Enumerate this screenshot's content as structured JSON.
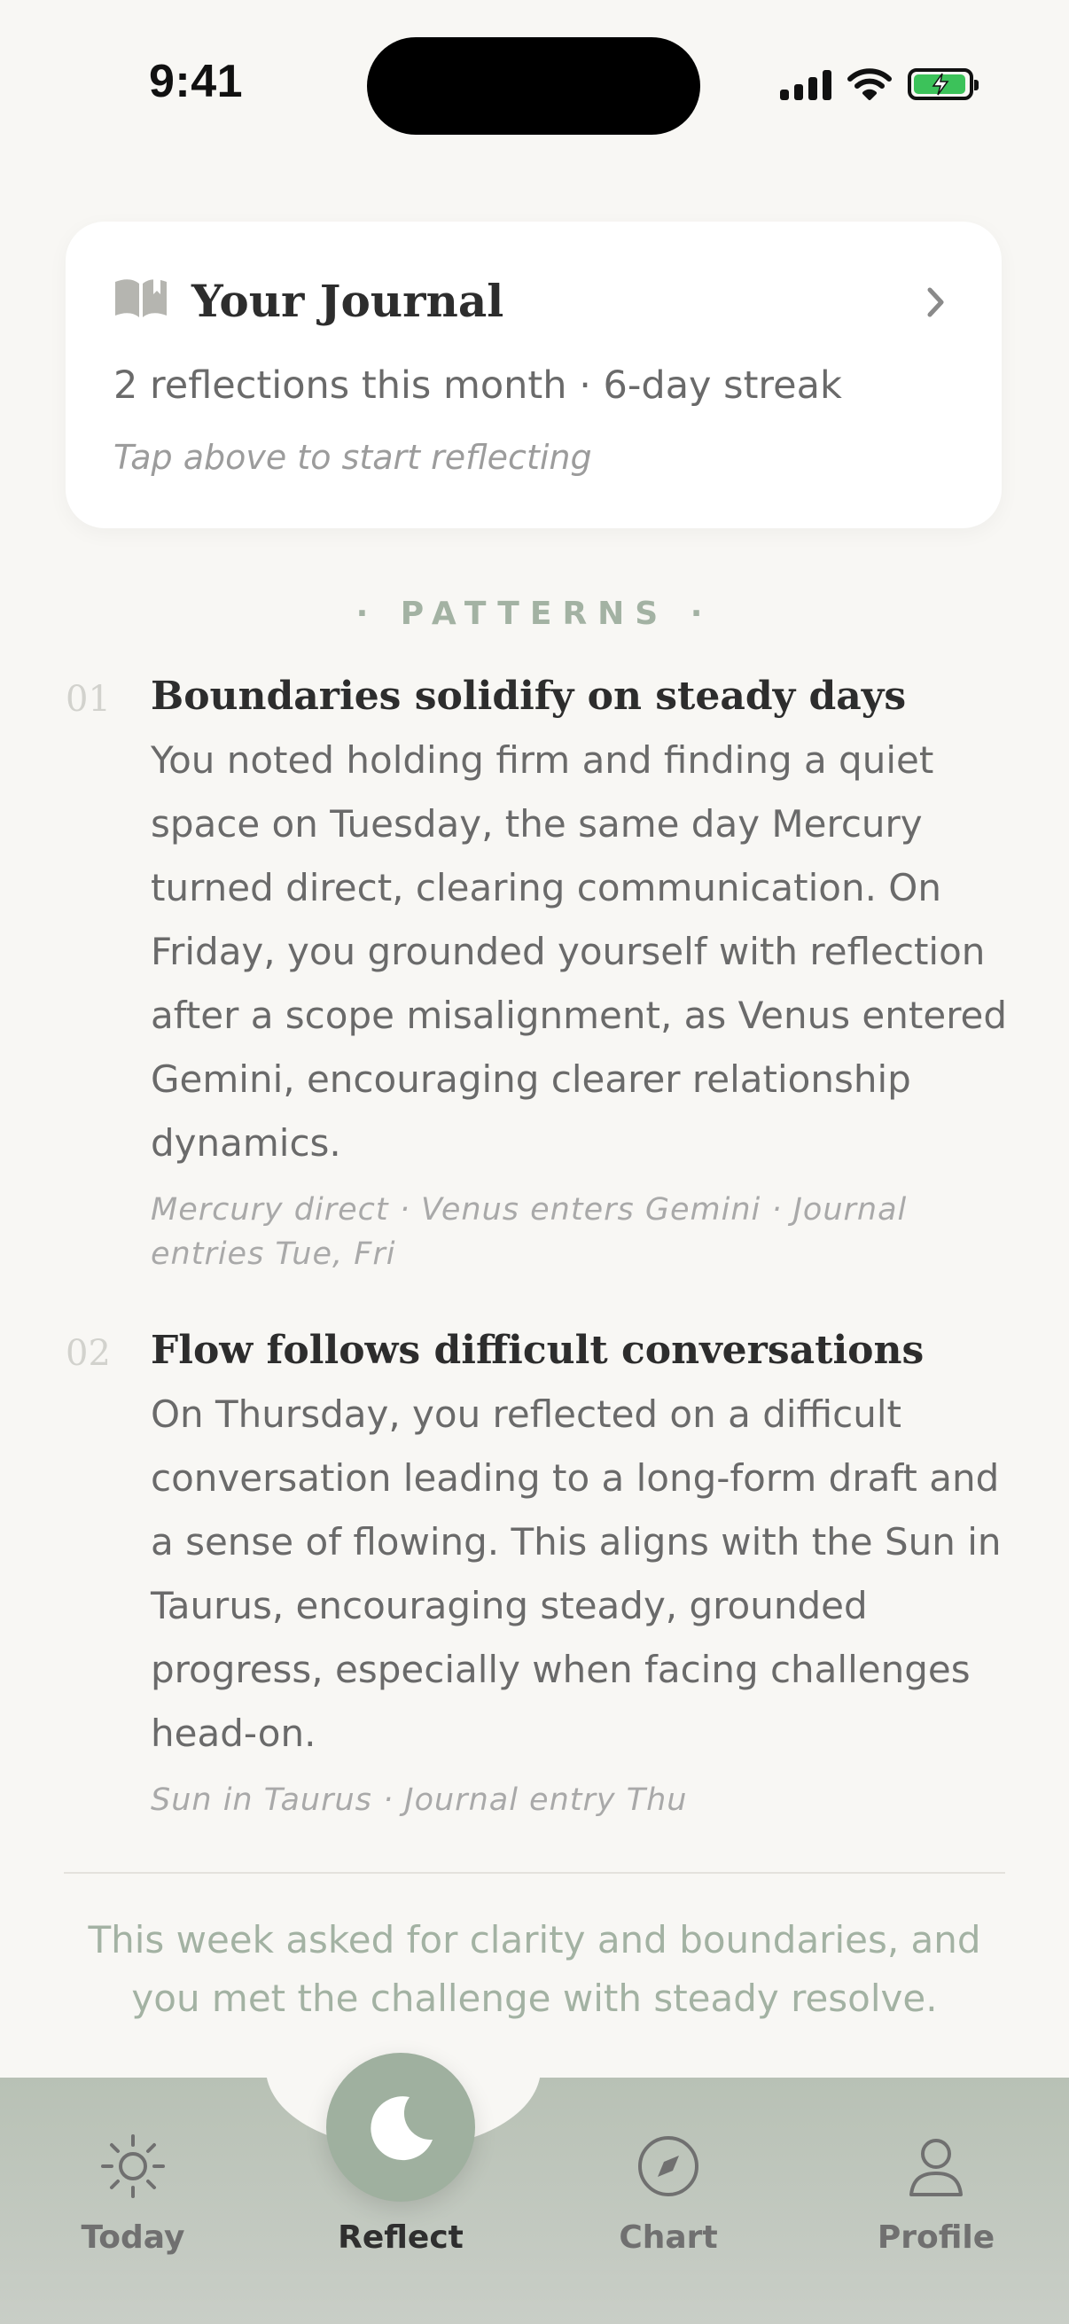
{
  "status_bar": {
    "time": "9:41"
  },
  "journal_card": {
    "icon": "open-book-icon",
    "title": "Your Journal",
    "stats": "2 reflections this month · 6-day streak",
    "hint": "Tap above to start reflecting"
  },
  "patterns": {
    "label": "· PATTERNS ·",
    "items": [
      {
        "number": "01",
        "title": "Boundaries solidify on steady days",
        "text": "You noted holding firm and finding a quiet space on Tuesday, the same day Mercury turned direct, clearing communication. On Friday, you grounded yourself with reflection after a scope misalignment, as Venus entered Gemini, encouraging clearer relationship dynamics.",
        "meta": "Mercury direct · Venus enters Gemini · Journal entries Tue, Fri"
      },
      {
        "number": "02",
        "title": "Flow follows difficult conversations",
        "text": "On Thursday, you reflected on a difficult conversation leading to a long-form draft and a sense of flowing. This aligns with the Sun in Taurus, encouraging steady, grounded progress, especially when facing challenges head-on.",
        "meta": "Sun in Taurus · Journal entry Thu"
      }
    ]
  },
  "summary": "This week asked for clarity and boundaries, and you met the challenge with steady resolve.",
  "tabbar": {
    "tabs": [
      {
        "label": "Today",
        "icon": "sun-icon"
      },
      {
        "label": "Reflect",
        "icon": "moon-icon",
        "active": true
      },
      {
        "label": "Chart",
        "icon": "compass-icon"
      },
      {
        "label": "Profile",
        "icon": "person-icon"
      }
    ]
  },
  "colors": {
    "background": "#f8f7f4",
    "accent": "#a3b2a3",
    "tabbar": "#c4cbc1",
    "battery": "#3cc25a"
  }
}
